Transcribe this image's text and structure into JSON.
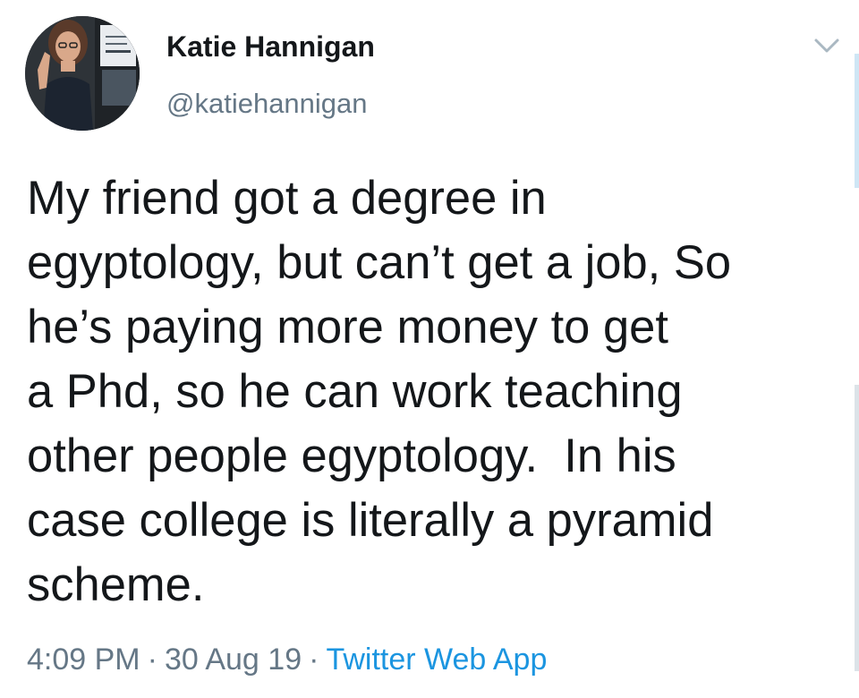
{
  "user": {
    "display_name": "Katie Hannigan",
    "handle": "@katiehannigan"
  },
  "tweet": {
    "lines": [
      "My friend got a degree in",
      "egyptology, but can’t get a job, So",
      "he’s paying more money to get",
      "a Phd, so he can work teaching",
      "other people egyptology.  In his",
      "case college is literally a pyramid",
      "scheme."
    ]
  },
  "meta": {
    "time": "4:09 PM",
    "separator": "·",
    "date": "30 Aug 19",
    "source": "Twitter Web App"
  },
  "icons": {
    "menu": "chevron-down-icon"
  },
  "colors": {
    "text": "#14171a",
    "secondary": "#657786",
    "link": "#1b95e0"
  }
}
